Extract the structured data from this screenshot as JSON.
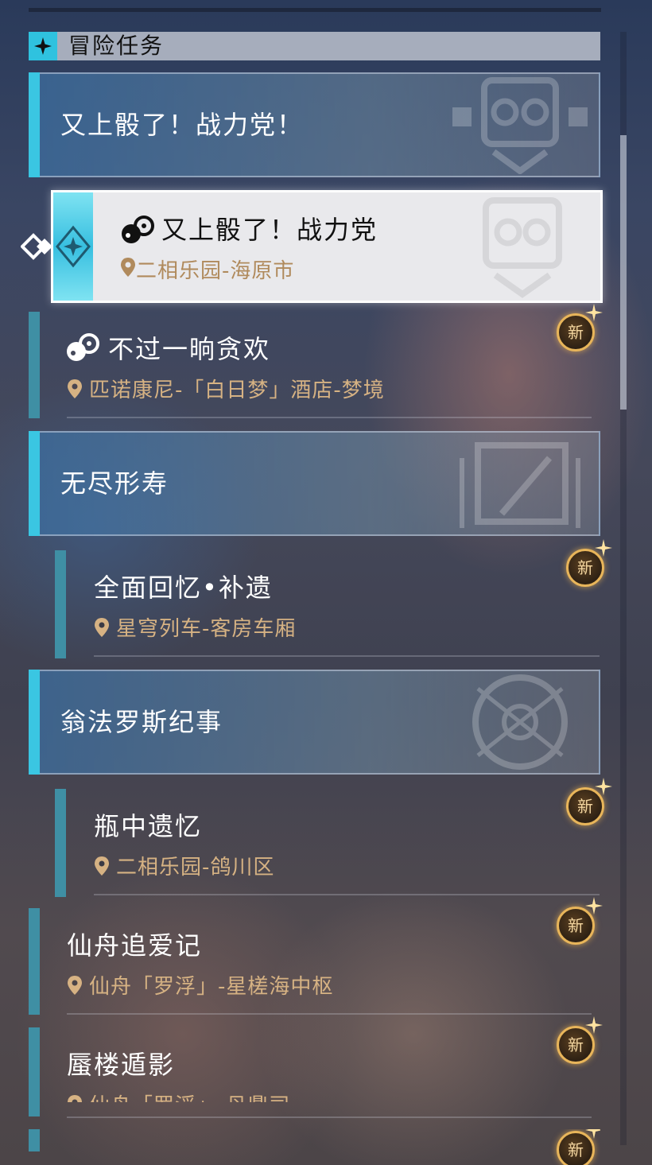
{
  "header": {
    "title": "冒险任务",
    "icon": "four-point-star-icon"
  },
  "categories": [
    {
      "title": "又上骰了！战力党！"
    },
    {
      "title": "无尽形寿"
    },
    {
      "title": "翁法罗斯纪事"
    }
  ],
  "selected_quest": {
    "title": "又上骰了！战力党",
    "location": "二相乐园-海原市",
    "icon": "dice-quest-icon"
  },
  "quests": [
    {
      "title": "不过一晌贪欢",
      "location": "匹诺康尼-「白日梦」酒店-梦境",
      "badge": "新"
    },
    {
      "title": "全面回忆•补遗",
      "location": "星穹列车-客房车厢",
      "badge": "新"
    },
    {
      "title": "瓶中遗忆",
      "location": "二相乐园-鸽川区",
      "badge": "新"
    },
    {
      "title": "仙舟追爱记",
      "location": "仙舟「罗浮」-星槎海中枢",
      "badge": "新"
    },
    {
      "title": "蜃楼遁影",
      "location": "仙舟「罗浮」-丹鼎司",
      "badge": "新"
    },
    {
      "badge": "新"
    }
  ],
  "colors": {
    "accent": "#3ac6e2",
    "badge_border": "#e8b55a",
    "location_text": "#d6b283"
  }
}
